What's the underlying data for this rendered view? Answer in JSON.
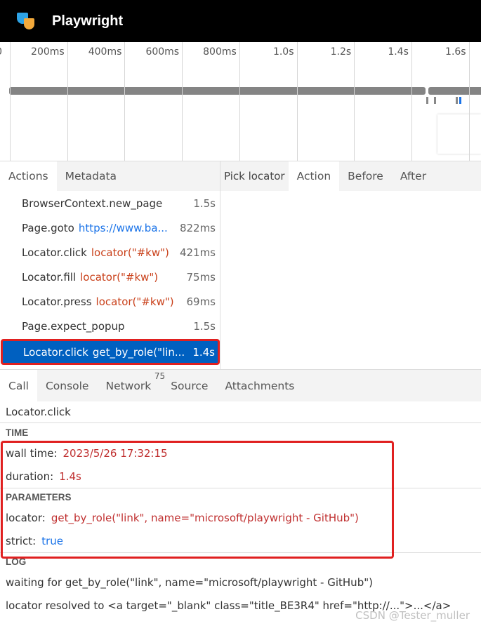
{
  "header": {
    "title": "Playwright"
  },
  "timeline": {
    "ticks": [
      "0",
      "200ms",
      "400ms",
      "600ms",
      "800ms",
      "1.0s",
      "1.2s",
      "1.4s",
      "1.6s"
    ]
  },
  "left_tabs": [
    "Actions",
    "Metadata"
  ],
  "actions": [
    {
      "name": "BrowserContext.new_page",
      "arg": "",
      "type": "",
      "dur": "1.5s"
    },
    {
      "name": "Page.goto",
      "arg": "https://www.ba...",
      "type": "url",
      "dur": "822ms"
    },
    {
      "name": "Locator.click",
      "arg": "locator(\"#kw\")",
      "type": "loc",
      "dur": "421ms"
    },
    {
      "name": "Locator.fill",
      "arg": "locator(\"#kw\")",
      "type": "loc",
      "dur": "75ms"
    },
    {
      "name": "Locator.press",
      "arg": "locator(\"#kw\")",
      "type": "loc",
      "dur": "69ms"
    },
    {
      "name": "Page.expect_popup",
      "arg": "",
      "type": "",
      "dur": "1.5s"
    },
    {
      "name": "Locator.click",
      "arg": "get_by_role(\"lin...",
      "type": "",
      "dur": "1.4s",
      "selected": true
    }
  ],
  "right_tabs": {
    "pick": "Pick locator",
    "tabs": [
      "Action",
      "Before",
      "After"
    ]
  },
  "bottom_tabs": {
    "tabs": [
      "Call",
      "Console",
      "Network",
      "Source",
      "Attachments"
    ],
    "network_badge": "75"
  },
  "call": {
    "title": "Locator.click",
    "time_header": "TIME",
    "wall_label": "wall time:",
    "wall_value": "2023/5/26 17:32:15",
    "duration_label": "duration:",
    "duration_value": "1.4s",
    "params_header": "PARAMETERS",
    "locator_label": "locator:",
    "locator_value": "get_by_role(\"link\", name=\"microsoft/playwright - GitHub\")",
    "strict_label": "strict:",
    "strict_value": "true",
    "log_header": "LOG",
    "log": [
      "waiting for get_by_role(\"link\", name=\"microsoft/playwright - GitHub\")",
      "locator resolved to <a target=\"_blank\" class=\"title_BE3R4\" href=\"http://...\">...</a>"
    ]
  },
  "watermark": "CSDN @Tester_muller"
}
